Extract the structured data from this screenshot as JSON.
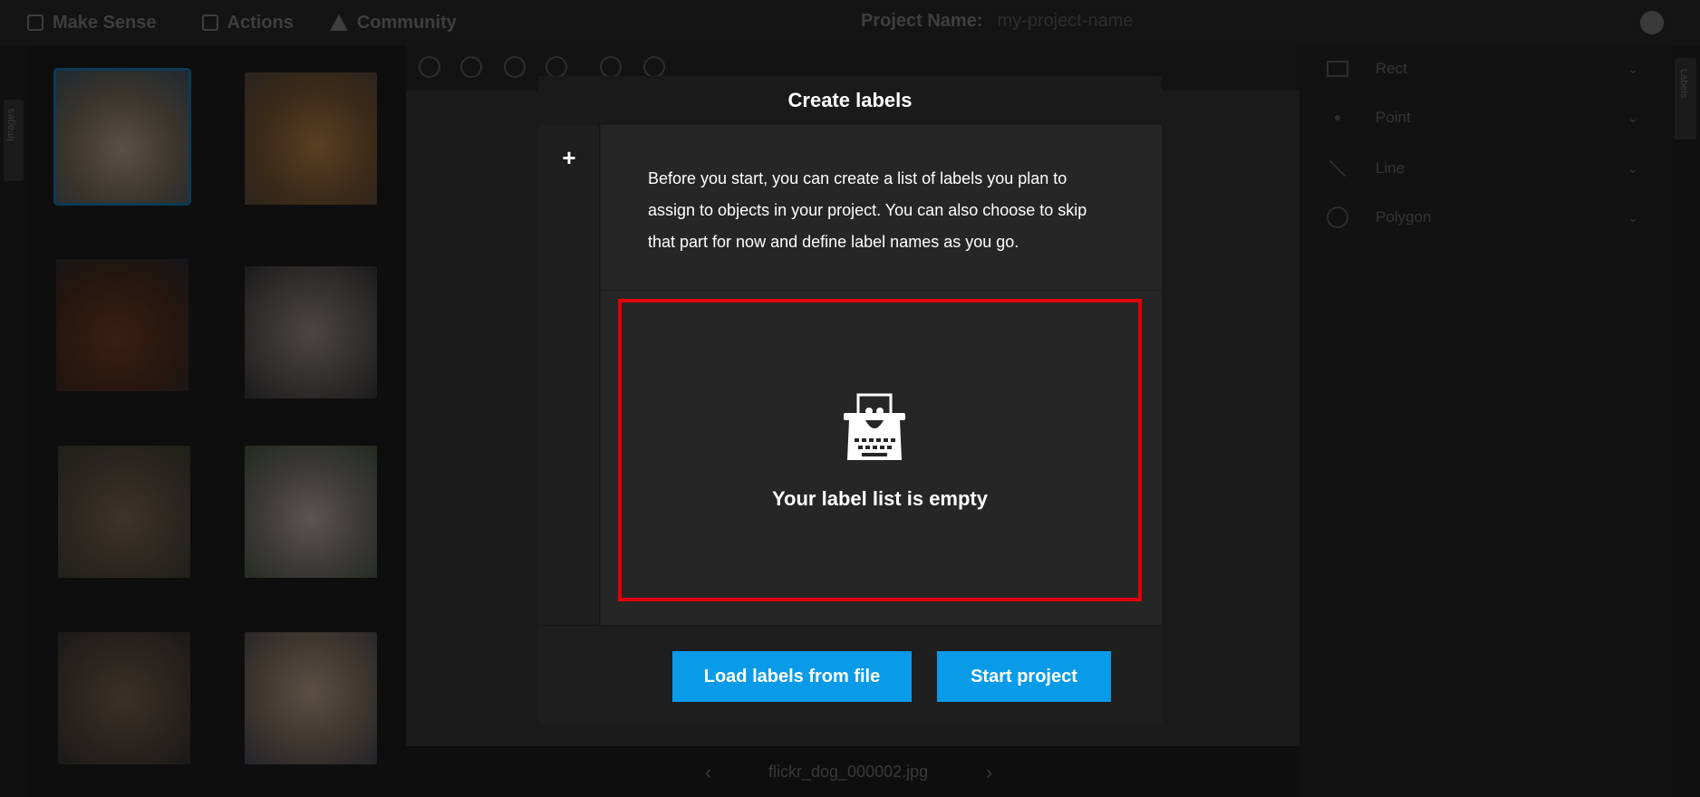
{
  "topbar": {
    "brand": "Make Sense",
    "actions": "Actions",
    "community": "Community",
    "project_label": "Project Name:",
    "project_value": "my-project-name"
  },
  "left_strip": {
    "tab_label": "Images"
  },
  "right_strip": {
    "tab_label": "Labels"
  },
  "right_panel": {
    "tools": [
      {
        "label": "Rect",
        "icon": "rect-icon"
      },
      {
        "label": "Point",
        "icon": "point-icon"
      },
      {
        "label": "Line",
        "icon": "line-icon"
      },
      {
        "label": "Polygon",
        "icon": "polygon-icon"
      }
    ]
  },
  "bottombar": {
    "filename": "flickr_dog_000002.jpg"
  },
  "modal": {
    "title": "Create labels",
    "plus": "+",
    "message": "Before you start, you can create a list of labels you plan to assign to objects in your project. You can also choose to skip that part for now and define label names as you go.",
    "empty_text": "Your label list is empty",
    "load_button": "Load labels from file",
    "start_button": "Start project"
  },
  "colors": {
    "accent": "#0a9be8",
    "highlight": "#e0000a"
  }
}
